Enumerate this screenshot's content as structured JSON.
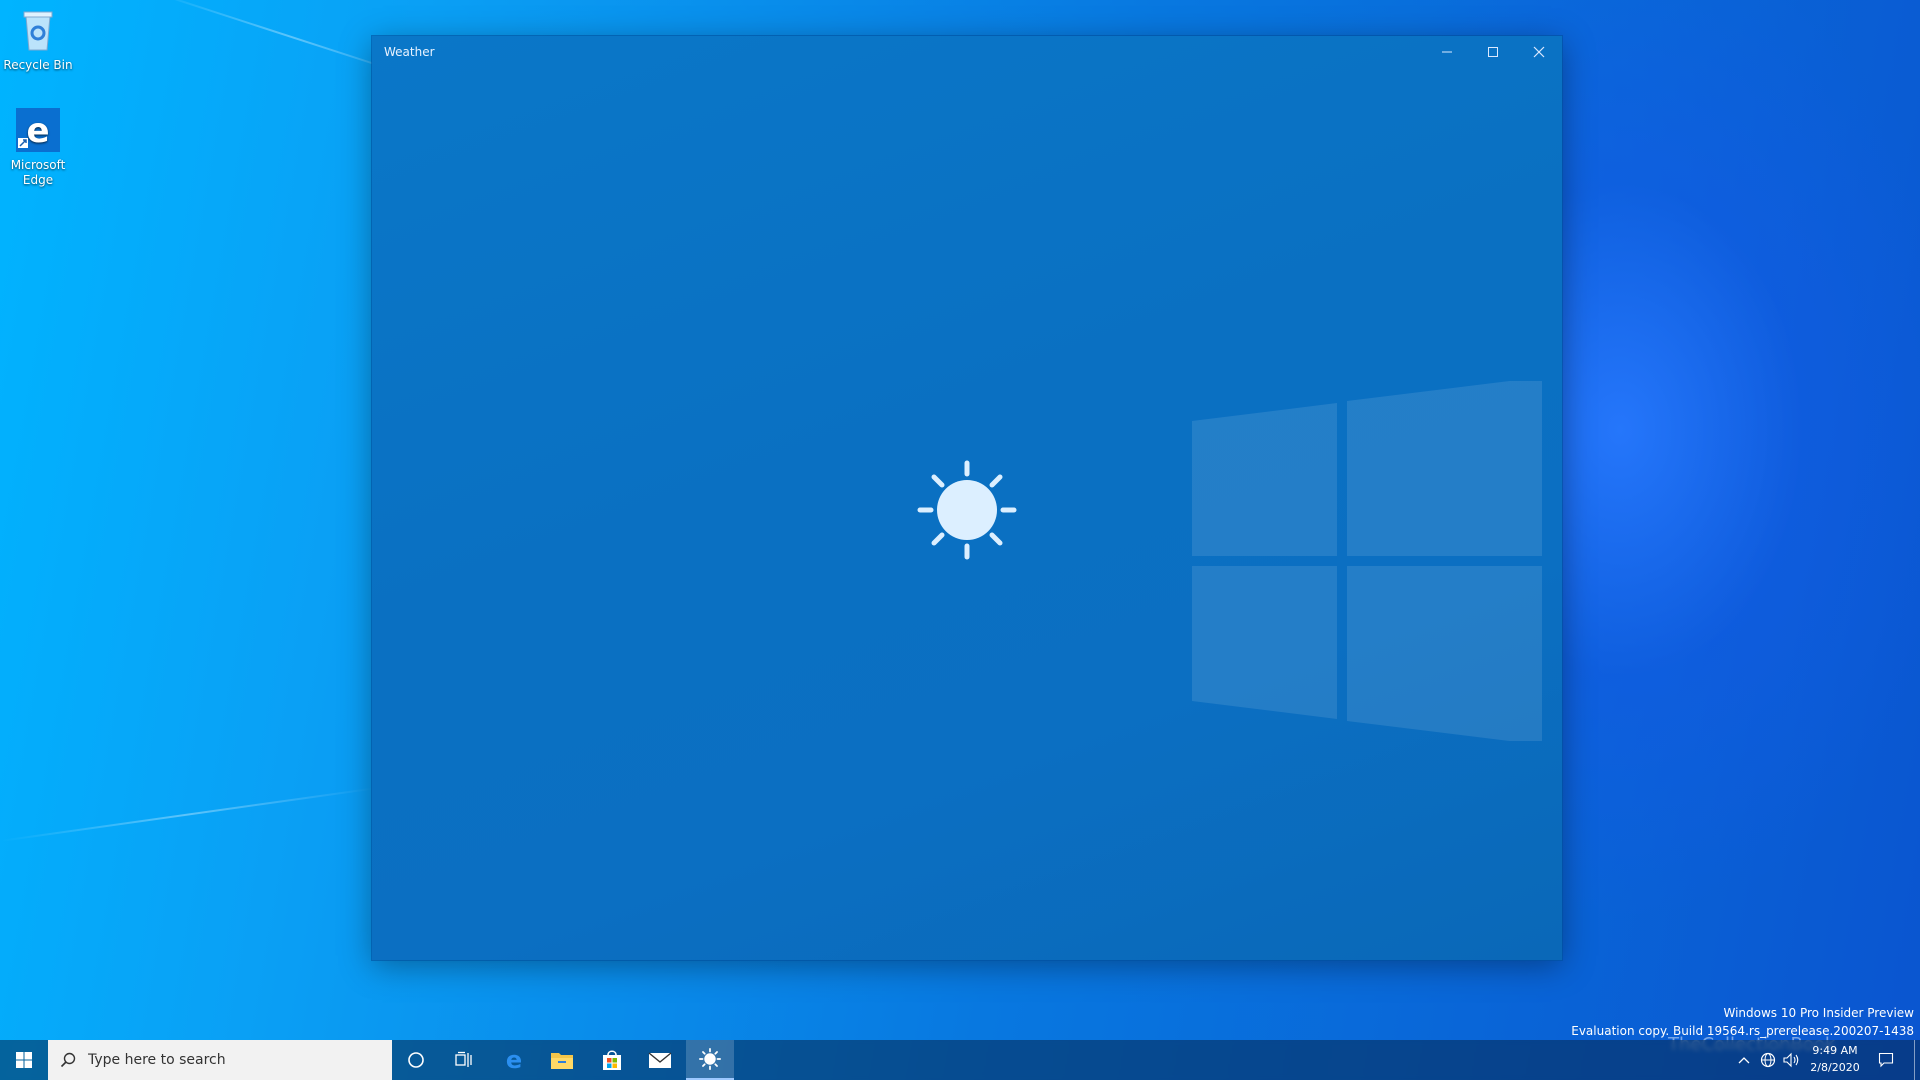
{
  "desktop": {
    "icons": [
      {
        "label": "Recycle Bin"
      },
      {
        "label": "Microsoft Edge"
      }
    ]
  },
  "window": {
    "title": "Weather",
    "controls": {
      "minimize": "minimize-icon",
      "maximize": "maximize-icon",
      "close": "close-icon"
    },
    "splash_icon": "sun-icon"
  },
  "watermark": {
    "line1": "Windows 10 Pro Insider Preview",
    "line2": "Evaluation copy. Build 19564.rs_prerelease.200207-1438"
  },
  "taskbar": {
    "search_placeholder": "Type here to search",
    "pinned": [
      "cortana-icon",
      "task-view-icon",
      "edge-icon",
      "file-explorer-icon",
      "store-icon",
      "mail-icon",
      "weather-icon"
    ],
    "active_app": "weather-icon",
    "tray": {
      "time": "9:49 AM",
      "date": "2/8/2020"
    },
    "overlay_text": "TheCollectionBook"
  },
  "colors": {
    "window_bg": "#0a70c2",
    "accent": "#0078d7",
    "taskbar_bg": "#1e3a5a"
  }
}
